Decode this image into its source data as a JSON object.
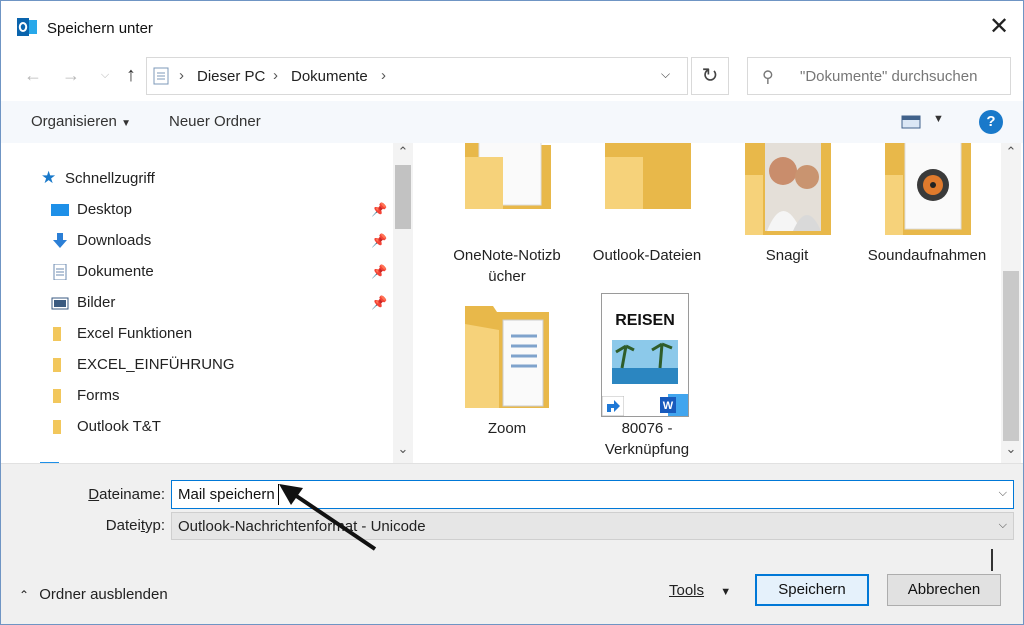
{
  "window": {
    "title": "Speichern unter",
    "close_glyph": "✕"
  },
  "nav": {
    "back_icon": "arrow-left-icon",
    "forward_icon": "arrow-right-icon",
    "recent_icon": "chevron-down-icon",
    "up_icon": "arrow-up-icon",
    "breadcrumb": [
      "Dieser PC",
      "Dokumente"
    ],
    "search_placeholder": "\"Dokumente\" durchsuchen"
  },
  "toolbar": {
    "organize": "Organisieren",
    "new_folder": "Neuer Ordner",
    "help": "?"
  },
  "sidebar": {
    "quick_access": "Schnellzugriff",
    "items": [
      {
        "label": "Desktop",
        "icon": "desktop-icon",
        "pinned": true
      },
      {
        "label": "Downloads",
        "icon": "download-icon",
        "pinned": true
      },
      {
        "label": "Dokumente",
        "icon": "document-icon",
        "pinned": true
      },
      {
        "label": "Bilder",
        "icon": "pictures-icon",
        "pinned": true
      },
      {
        "label": "Excel Funktionen",
        "icon": "folder-icon",
        "pinned": false
      },
      {
        "label": "EXCEL_EINFÜHRUNG",
        "icon": "folder-icon",
        "pinned": false
      },
      {
        "label": "Forms",
        "icon": "folder-icon",
        "pinned": false
      },
      {
        "label": "Outlook T&T",
        "icon": "folder-icon",
        "pinned": false
      }
    ]
  },
  "files": [
    {
      "line1": "OneNote-Notizb",
      "line2": "ücher",
      "icon": "folder-icon"
    },
    {
      "line1": "Outlook-Dateien",
      "line2": "",
      "icon": "folder-icon"
    },
    {
      "line1": "Snagit",
      "line2": "",
      "icon": "folder-photo-icon"
    },
    {
      "line1": "Soundaufnahmen",
      "line2": "",
      "icon": "folder-audio-icon"
    },
    {
      "line1": "Zoom",
      "line2": "",
      "icon": "folder-docs-icon"
    },
    {
      "line1": "80076 -",
      "line2": "Verknüpfung",
      "icon": "word-shortcut-icon",
      "thumb_text": "REISEN"
    }
  ],
  "form": {
    "filename_label": "Dateiname:",
    "filename_value": "Mail speichern",
    "filetype_label": "Dateityp:",
    "filetype_value": "Outlook-Nachrichtenformat - Unicode"
  },
  "footer": {
    "hide_folders": "Ordner ausblenden",
    "tools": "Tools",
    "save": "Speichern",
    "cancel": "Abbrechen"
  },
  "colors": {
    "accent": "#0078d7",
    "folder": "#f2c75c",
    "help": "#1979ca"
  }
}
